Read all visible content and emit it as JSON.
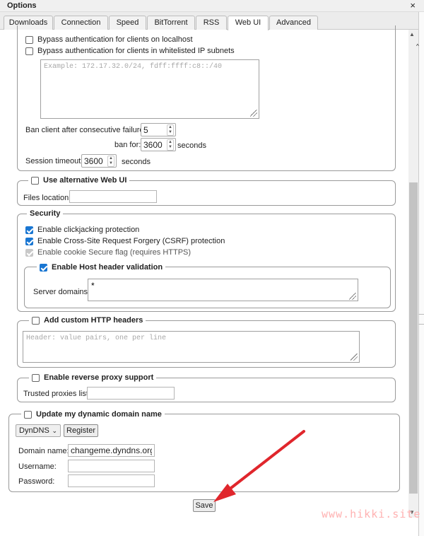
{
  "window": {
    "title": "Options",
    "close_glyph": "×"
  },
  "tabs": [
    {
      "label": "Downloads"
    },
    {
      "label": "Connection"
    },
    {
      "label": "Speed"
    },
    {
      "label": "BitTorrent"
    },
    {
      "label": "RSS"
    },
    {
      "label": "Web UI",
      "active": true
    },
    {
      "label": "Advanced"
    }
  ],
  "auth": {
    "bypass_localhost": "Bypass authentication for clients on localhost",
    "bypass_whitelist": "Bypass authentication for clients in whitelisted IP subnets",
    "subnets_placeholder": "Example: 172.17.32.0/24, fdff:ffff:c8::/40",
    "ban_label": "Ban client after consecutive failures:",
    "ban_failures": "5",
    "ban_for_label": "ban for:",
    "ban_for_value": "3600",
    "seconds_1": "seconds",
    "session_label": "Session timeout:",
    "session_value": "3600",
    "seconds_2": "seconds"
  },
  "alt_ui": {
    "legend": "Use alternative Web UI",
    "files_location_label": "Files location:",
    "files_location_value": ""
  },
  "security": {
    "legend": "Security",
    "clickjacking": "Enable clickjacking protection",
    "csrf": "Enable Cross-Site Request Forgery (CSRF) protection",
    "cookie_secure": "Enable cookie Secure flag (requires HTTPS)",
    "host_header_legend": "Enable Host header validation",
    "server_domains_label": "Server domains:",
    "server_domains_value": "*"
  },
  "custom_headers": {
    "legend": "Add custom HTTP headers",
    "placeholder": "Header: value pairs, one per line"
  },
  "reverse_proxy": {
    "legend": "Enable reverse proxy support",
    "trusted_label": "Trusted proxies list:",
    "trusted_value": ""
  },
  "dyndns": {
    "legend": "Update my dynamic domain name",
    "service": "DynDNS",
    "register_label": "Register",
    "domain_label": "Domain name:",
    "domain_value": "changeme.dyndns.org",
    "username_label": "Username:",
    "username_value": "",
    "password_label": "Password:",
    "password_value": ""
  },
  "footer": {
    "save_label": "Save"
  },
  "watermark": "www.hikki.site",
  "colors": {
    "checkbox_accent": "#1976d2",
    "annotation_arrow": "#e0262c"
  }
}
